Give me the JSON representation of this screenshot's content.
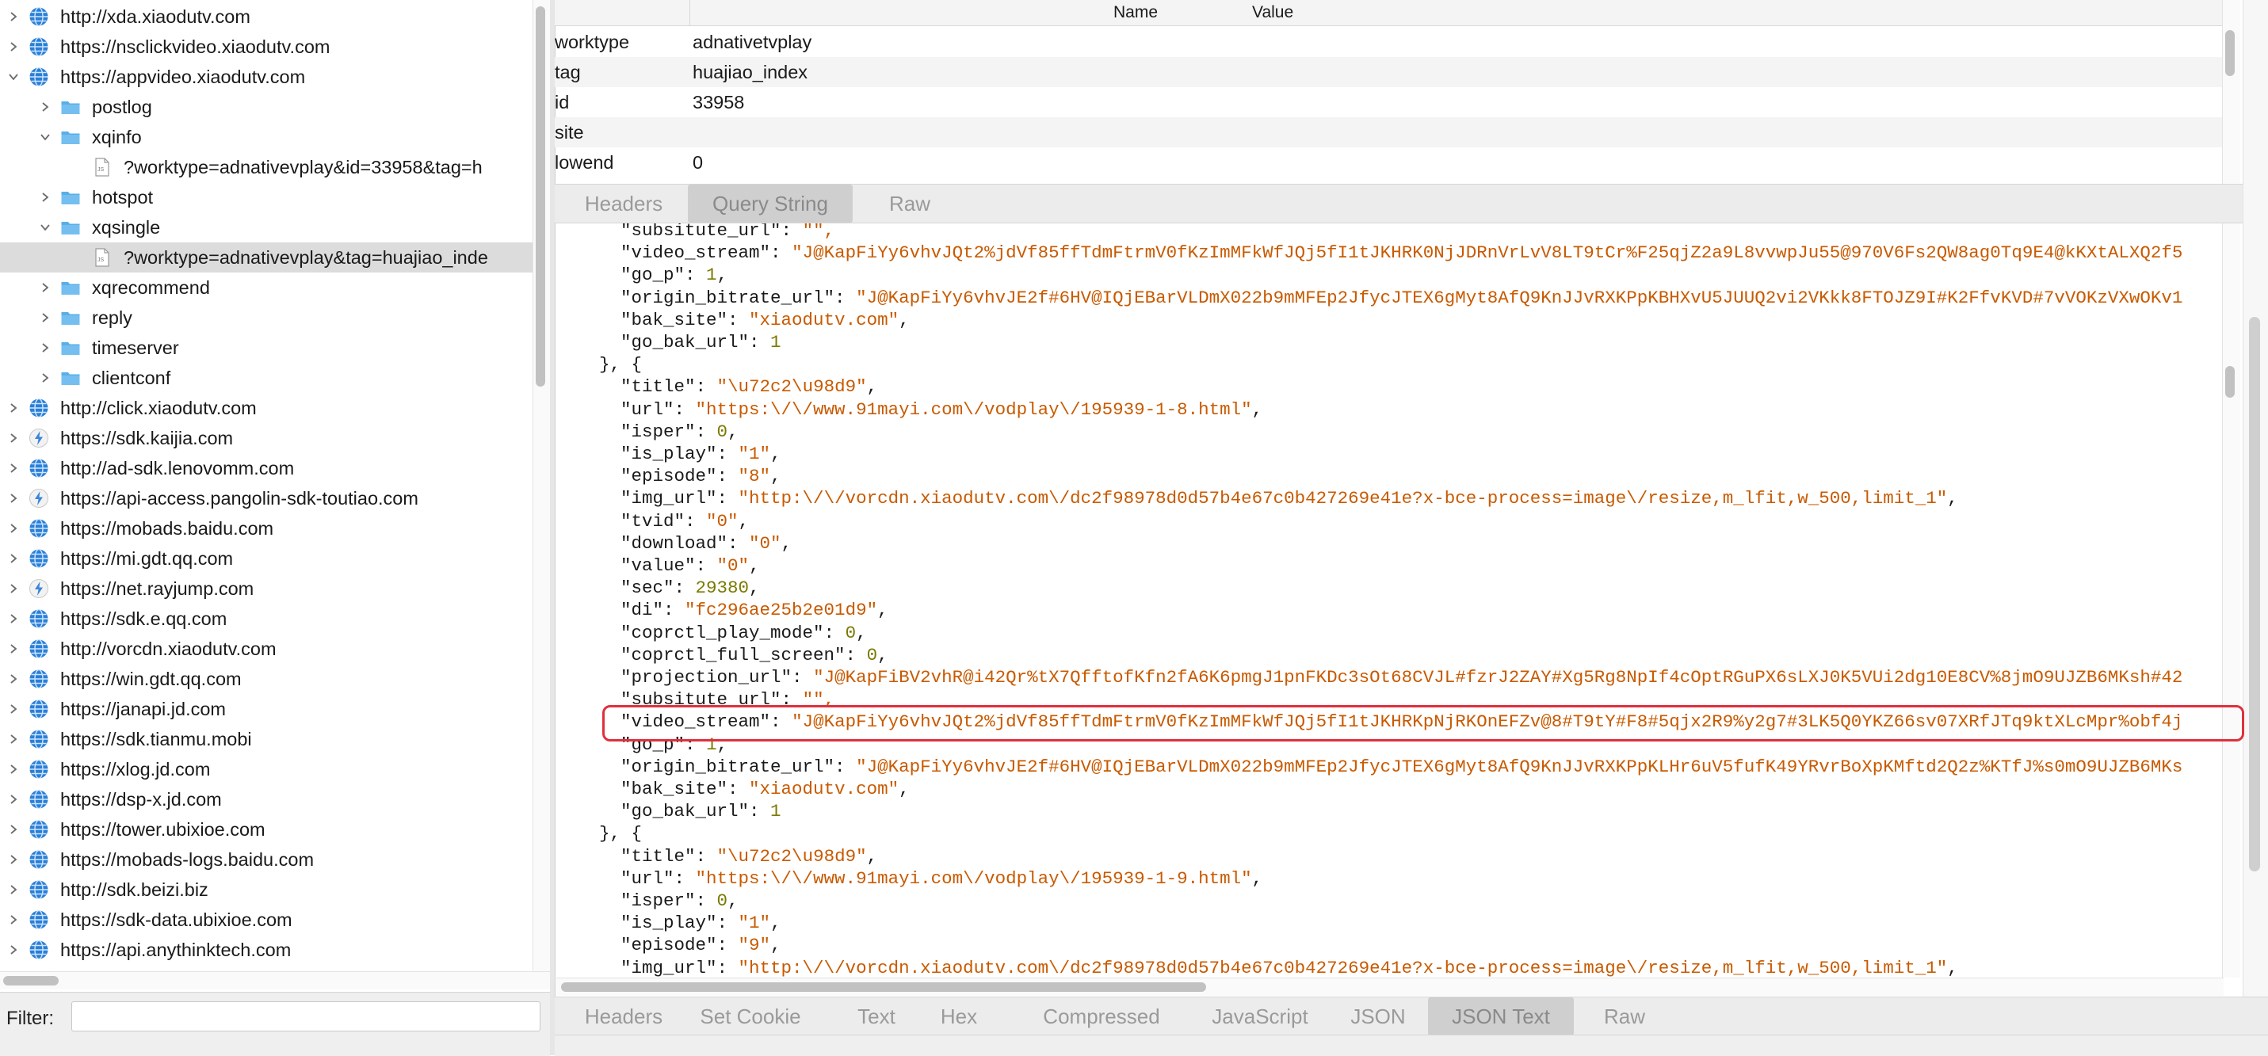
{
  "tree": {
    "items": [
      {
        "label": "http://xda.xiaodutv.com",
        "level": 0,
        "expanded": false,
        "icon": "globe-icon"
      },
      {
        "label": "https://nsclickvideo.xiaodutv.com",
        "level": 0,
        "expanded": false,
        "icon": "globe-icon"
      },
      {
        "label": "https://appvideo.xiaodutv.com",
        "level": 0,
        "expanded": true,
        "icon": "globe-icon"
      },
      {
        "label": "postlog",
        "level": 1,
        "expanded": false,
        "icon": "folder-icon"
      },
      {
        "label": "xqinfo",
        "level": 1,
        "expanded": true,
        "icon": "folder-icon"
      },
      {
        "label": "?worktype=adnativevplay&id=33958&tag=h",
        "level": 2,
        "expanded": null,
        "icon": "js-file-icon"
      },
      {
        "label": "hotspot",
        "level": 1,
        "expanded": false,
        "icon": "folder-icon"
      },
      {
        "label": "xqsingle",
        "level": 1,
        "expanded": true,
        "icon": "folder-icon"
      },
      {
        "label": "?worktype=adnativevplay&tag=huajiao_inde",
        "level": 2,
        "expanded": null,
        "icon": "js-file-icon",
        "selected": true
      },
      {
        "label": "xqrecommend",
        "level": 1,
        "expanded": false,
        "icon": "folder-icon"
      },
      {
        "label": "reply",
        "level": 1,
        "expanded": false,
        "icon": "folder-icon"
      },
      {
        "label": "timeserver",
        "level": 1,
        "expanded": false,
        "icon": "folder-icon"
      },
      {
        "label": "clientconf",
        "level": 1,
        "expanded": false,
        "icon": "folder-icon"
      },
      {
        "label": "http://click.xiaodutv.com",
        "level": 0,
        "expanded": false,
        "icon": "globe-icon"
      },
      {
        "label": "https://sdk.kaijia.com",
        "level": 0,
        "expanded": false,
        "icon": "lightning-icon"
      },
      {
        "label": "http://ad-sdk.lenovomm.com",
        "level": 0,
        "expanded": false,
        "icon": "globe-icon"
      },
      {
        "label": "https://api-access.pangolin-sdk-toutiao.com",
        "level": 0,
        "expanded": false,
        "icon": "lightning-icon"
      },
      {
        "label": "https://mobads.baidu.com",
        "level": 0,
        "expanded": false,
        "icon": "globe-icon"
      },
      {
        "label": "https://mi.gdt.qq.com",
        "level": 0,
        "expanded": false,
        "icon": "globe-icon"
      },
      {
        "label": "https://net.rayjump.com",
        "level": 0,
        "expanded": false,
        "icon": "lightning-icon"
      },
      {
        "label": "https://sdk.e.qq.com",
        "level": 0,
        "expanded": false,
        "icon": "globe-icon"
      },
      {
        "label": "http://vorcdn.xiaodutv.com",
        "level": 0,
        "expanded": false,
        "icon": "globe-icon"
      },
      {
        "label": "https://win.gdt.qq.com",
        "level": 0,
        "expanded": false,
        "icon": "globe-icon"
      },
      {
        "label": "https://janapi.jd.com",
        "level": 0,
        "expanded": false,
        "icon": "globe-icon"
      },
      {
        "label": "https://sdk.tianmu.mobi",
        "level": 0,
        "expanded": false,
        "icon": "globe-icon"
      },
      {
        "label": "https://xlog.jd.com",
        "level": 0,
        "expanded": false,
        "icon": "globe-icon"
      },
      {
        "label": "https://dsp-x.jd.com",
        "level": 0,
        "expanded": false,
        "icon": "globe-icon"
      },
      {
        "label": "https://tower.ubixioe.com",
        "level": 0,
        "expanded": false,
        "icon": "globe-icon"
      },
      {
        "label": "https://mobads-logs.baidu.com",
        "level": 0,
        "expanded": false,
        "icon": "globe-icon"
      },
      {
        "label": "http://sdk.beizi.biz",
        "level": 0,
        "expanded": false,
        "icon": "globe-icon"
      },
      {
        "label": "https://sdk-data.ubixioe.com",
        "level": 0,
        "expanded": false,
        "icon": "globe-icon"
      },
      {
        "label": "https://api.anythinktech.com",
        "level": 0,
        "expanded": false,
        "icon": "globe-icon"
      }
    ]
  },
  "filter": {
    "label": "Filter:",
    "value": ""
  },
  "query_table": {
    "headers": {
      "name": "Name",
      "value": "Value"
    },
    "rows": [
      {
        "name": "worktype",
        "value": "adnativetvplay"
      },
      {
        "name": "tag",
        "value": "huajiao_index"
      },
      {
        "name": "id",
        "value": "33958"
      },
      {
        "name": "site",
        "value": ""
      },
      {
        "name": "lowend",
        "value": "0"
      }
    ]
  },
  "request_tabs": [
    {
      "label": "Headers",
      "active": false
    },
    {
      "label": "Query String",
      "active": true
    },
    {
      "label": "Raw",
      "active": false
    }
  ],
  "response_tabs": [
    {
      "label": "Headers",
      "active": false
    },
    {
      "label": "Set Cookie",
      "active": false
    },
    {
      "label": "Text",
      "active": false
    },
    {
      "label": "Hex",
      "active": false
    },
    {
      "label": "Compressed",
      "active": false
    },
    {
      "label": "JavaScript",
      "active": false
    },
    {
      "label": "JSON",
      "active": false
    },
    {
      "label": "JSON Text",
      "active": true
    },
    {
      "label": "Raw",
      "active": false
    }
  ],
  "json_lines": [
    {
      "indent": "      ",
      "parts": [
        [
          "k",
          "\"subsitute_url\": "
        ],
        [
          "s",
          "\"\","
        ]
      ]
    },
    {
      "indent": "      ",
      "parts": [
        [
          "k",
          "\"video_stream\": "
        ],
        [
          "s",
          "\"J@KapFiYy6vhvJQt2%jdVf85ffTdmFtrmV0fKzImMFkWfJQj5fI1tJKHRK0NjJDRnVrLvV8LT9tCr%F25qjZ2a9L8vvwpJu55@970V6Fs2QW8ag0Tq9E4@kKXtALXQ2f5"
        ]
      ]
    },
    {
      "indent": "      ",
      "parts": [
        [
          "k",
          "\"go_p\": "
        ],
        [
          "n",
          "1"
        ],
        [
          "k",
          ","
        ]
      ]
    },
    {
      "indent": "      ",
      "parts": [
        [
          "k",
          "\"origin_bitrate_url\": "
        ],
        [
          "s",
          "\"J@KapFiYy6vhvJE2f#6HV@IQjEBarVLDmX022b9mMFEp2JfycJTEX6gMyt8AfQ9KnJJvRXKPpKBHXvU5JUUQ2vi2VKkk8FTOJZ9I#K2FfvKVD#7vVOKzVXwOKv1"
        ]
      ]
    },
    {
      "indent": "      ",
      "parts": [
        [
          "k",
          "\"bak_site\": "
        ],
        [
          "s",
          "\"xiaodutv.com\""
        ],
        [
          "k",
          ","
        ]
      ]
    },
    {
      "indent": "      ",
      "parts": [
        [
          "k",
          "\"go_bak_url\": "
        ],
        [
          "n",
          "1"
        ]
      ]
    },
    {
      "indent": "    ",
      "parts": [
        [
          "k",
          "}, {"
        ]
      ]
    },
    {
      "indent": "      ",
      "parts": [
        [
          "k",
          "\"title\": "
        ],
        [
          "s",
          "\"\\u72c2\\u98d9\""
        ],
        [
          "k",
          ","
        ]
      ]
    },
    {
      "indent": "      ",
      "parts": [
        [
          "k",
          "\"url\": "
        ],
        [
          "s",
          "\"https:\\/\\/www.91mayi.com\\/vodplay\\/195939-1-8.html\""
        ],
        [
          "k",
          ","
        ]
      ]
    },
    {
      "indent": "      ",
      "parts": [
        [
          "k",
          "\"isper\": "
        ],
        [
          "n",
          "0"
        ],
        [
          "k",
          ","
        ]
      ]
    },
    {
      "indent": "      ",
      "parts": [
        [
          "k",
          "\"is_play\": "
        ],
        [
          "s",
          "\"1\""
        ],
        [
          "k",
          ","
        ]
      ]
    },
    {
      "indent": "      ",
      "parts": [
        [
          "k",
          "\"episode\": "
        ],
        [
          "s",
          "\"8\""
        ],
        [
          "k",
          ","
        ]
      ]
    },
    {
      "indent": "      ",
      "parts": [
        [
          "k",
          "\"img_url\": "
        ],
        [
          "s",
          "\"http:\\/\\/vorcdn.xiaodutv.com\\/dc2f98978d0d57b4e67c0b427269e41e?x-bce-process=image\\/resize,m_lfit,w_500,limit_1\""
        ],
        [
          "k",
          ","
        ]
      ]
    },
    {
      "indent": "      ",
      "parts": [
        [
          "k",
          "\"tvid\": "
        ],
        [
          "s",
          "\"0\""
        ],
        [
          "k",
          ","
        ]
      ]
    },
    {
      "indent": "      ",
      "parts": [
        [
          "k",
          "\"download\": "
        ],
        [
          "s",
          "\"0\""
        ],
        [
          "k",
          ","
        ]
      ]
    },
    {
      "indent": "      ",
      "parts": [
        [
          "k",
          "\"value\": "
        ],
        [
          "s",
          "\"0\""
        ],
        [
          "k",
          ","
        ]
      ]
    },
    {
      "indent": "      ",
      "parts": [
        [
          "k",
          "\"sec\": "
        ],
        [
          "n",
          "29380"
        ],
        [
          "k",
          ","
        ]
      ]
    },
    {
      "indent": "      ",
      "parts": [
        [
          "k",
          "\"di\": "
        ],
        [
          "s",
          "\"fc296ae25b2e01d9\""
        ],
        [
          "k",
          ","
        ]
      ]
    },
    {
      "indent": "      ",
      "parts": [
        [
          "k",
          "\"coprctl_play_mode\": "
        ],
        [
          "n",
          "0"
        ],
        [
          "k",
          ","
        ]
      ]
    },
    {
      "indent": "      ",
      "parts": [
        [
          "k",
          "\"coprctl_full_screen\": "
        ],
        [
          "n",
          "0"
        ],
        [
          "k",
          ","
        ]
      ]
    },
    {
      "indent": "      ",
      "parts": [
        [
          "k",
          "\"projection_url\": "
        ],
        [
          "s",
          "\"J@KapFiBV2vhR@i42Qr%tX7QfftofKfn2fA6K6pmgJ1pnFKDc3sOt68CVJL#fzrJ2ZAY#Xg5Rg8NpIf4cOptRGuPX6sLXJ0K5VUi2dg10E8CV%8jmO9UJZB6MKsh#42"
        ]
      ]
    },
    {
      "indent": "      ",
      "parts": [
        [
          "k",
          "\"subsitute_url\": "
        ],
        [
          "s",
          "\"\","
        ]
      ]
    },
    {
      "indent": "      ",
      "parts": [
        [
          "k",
          "\"video_stream\": "
        ],
        [
          "s",
          "\"J@KapFiYy6vhvJQt2%jdVf85ffTdmFtrmV0fKzImMFkWfJQj5fI1tJKHRKpNjRKOnEFZv@8#T9tY#F8#5qjx2R9%y2g7#3LK5Q0YKZ66sv07XRfJTq9ktXLcMpr%obf4j"
        ]
      ]
    },
    {
      "indent": "      ",
      "parts": [
        [
          "k",
          "\"go_p\": "
        ],
        [
          "n",
          "1"
        ],
        [
          "k",
          ","
        ]
      ]
    },
    {
      "indent": "      ",
      "parts": [
        [
          "k",
          "\"origin_bitrate_url\": "
        ],
        [
          "s",
          "\"J@KapFiYy6vhvJE2f#6HV@IQjEBarVLDmX022b9mMFEp2JfycJTEX6gMyt8AfQ9KnJJvRXKPpKLHr6uV5fufK49YRvrBoXpKMftd2Q2z%KTfJ%s0mO9UJZB6MKs"
        ]
      ]
    },
    {
      "indent": "      ",
      "parts": [
        [
          "k",
          "\"bak_site\": "
        ],
        [
          "s",
          "\"xiaodutv.com\""
        ],
        [
          "k",
          ","
        ]
      ]
    },
    {
      "indent": "      ",
      "parts": [
        [
          "k",
          "\"go_bak_url\": "
        ],
        [
          "n",
          "1"
        ]
      ]
    },
    {
      "indent": "    ",
      "parts": [
        [
          "k",
          "}, {"
        ]
      ]
    },
    {
      "indent": "      ",
      "parts": [
        [
          "k",
          "\"title\": "
        ],
        [
          "s",
          "\"\\u72c2\\u98d9\""
        ],
        [
          "k",
          ","
        ]
      ]
    },
    {
      "indent": "      ",
      "parts": [
        [
          "k",
          "\"url\": "
        ],
        [
          "s",
          "\"https:\\/\\/www.91mayi.com\\/vodplay\\/195939-1-9.html\""
        ],
        [
          "k",
          ","
        ]
      ]
    },
    {
      "indent": "      ",
      "parts": [
        [
          "k",
          "\"isper\": "
        ],
        [
          "n",
          "0"
        ],
        [
          "k",
          ","
        ]
      ]
    },
    {
      "indent": "      ",
      "parts": [
        [
          "k",
          "\"is_play\": "
        ],
        [
          "s",
          "\"1\""
        ],
        [
          "k",
          ","
        ]
      ]
    },
    {
      "indent": "      ",
      "parts": [
        [
          "k",
          "\"episode\": "
        ],
        [
          "s",
          "\"9\""
        ],
        [
          "k",
          ","
        ]
      ]
    },
    {
      "indent": "      ",
      "parts": [
        [
          "k",
          "\"img_url\": "
        ],
        [
          "s",
          "\"http:\\/\\/vorcdn.xiaodutv.com\\/dc2f98978d0d57b4e67c0b427269e41e?x-bce-process=image\\/resize,m_lfit,w_500,limit_1\""
        ],
        [
          "k",
          ","
        ]
      ]
    }
  ],
  "colors": {
    "json_key": "#1a1a1a",
    "json_string": "#c85a00",
    "json_number": "#7a7a00",
    "highlight_box": "#e0303c",
    "selected_row": "#dcdcdc",
    "folder": "#5aaee8",
    "globe": "#2a7fd6"
  }
}
